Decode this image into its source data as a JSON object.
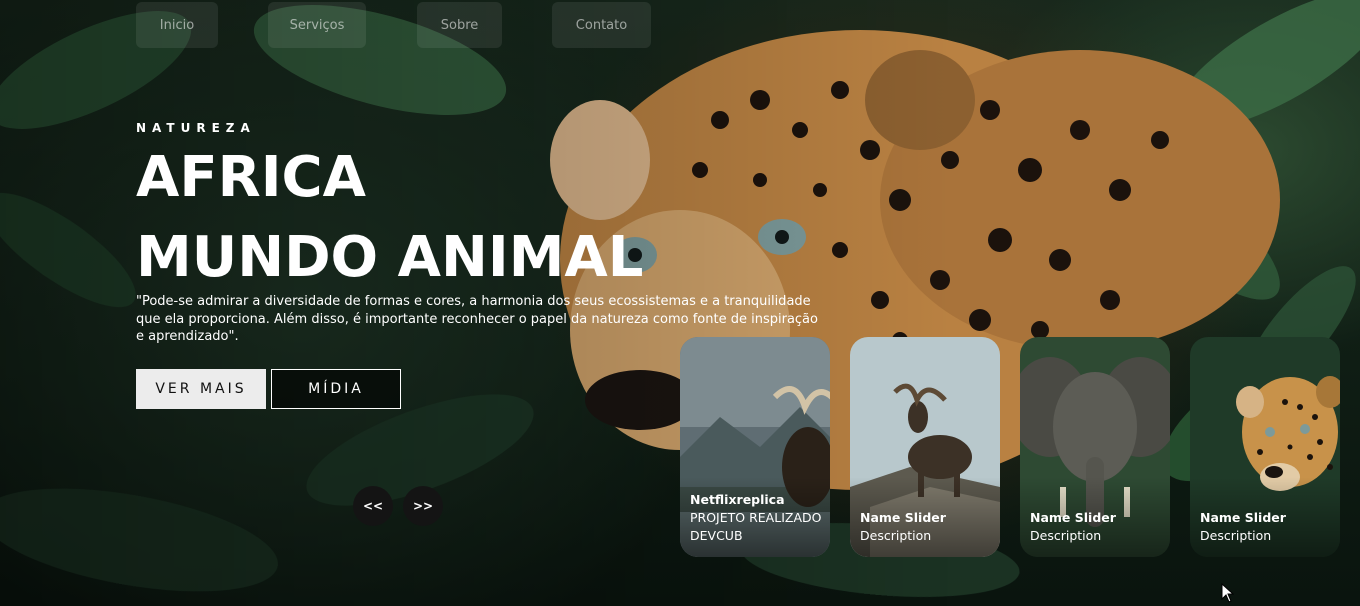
{
  "nav": {
    "items": [
      {
        "label": "Inicio"
      },
      {
        "label": "Serviços"
      },
      {
        "label": "Sobre"
      },
      {
        "label": "Contato"
      }
    ]
  },
  "hero": {
    "eyebrow": "NATUREZA",
    "title_line1": "AFRICA",
    "title_line2": "MUNDO ANIMAL",
    "description": "\"Pode-se admirar a diversidade de formas e cores, a harmonia dos seus ecossistemas e a tranquilidade que ela proporciona. Além disso, é importante reconhecer o papel da natureza como fonte de inspiração e aprendizado\".",
    "primary_button": "VER MAIS",
    "secondary_button": "MÍDIA"
  },
  "slider": {
    "prev_label": "<<",
    "next_label": ">>",
    "cards": [
      {
        "title": "Netflixreplica",
        "desc": "PROJETO REALIZADO DEVCUB",
        "image": "moose-in-mountain-lake"
      },
      {
        "title": "Name Slider",
        "desc": "Description",
        "image": "moose-on-rock"
      },
      {
        "title": "Name Slider",
        "desc": "Description",
        "image": "elephant"
      },
      {
        "title": "Name Slider",
        "desc": "Description",
        "image": "jaguar"
      }
    ]
  },
  "colors": {
    "accent_light": "#ececec",
    "dark": "#141414",
    "jungle": "#17281c",
    "jaguar_fur": "#c8924a"
  }
}
